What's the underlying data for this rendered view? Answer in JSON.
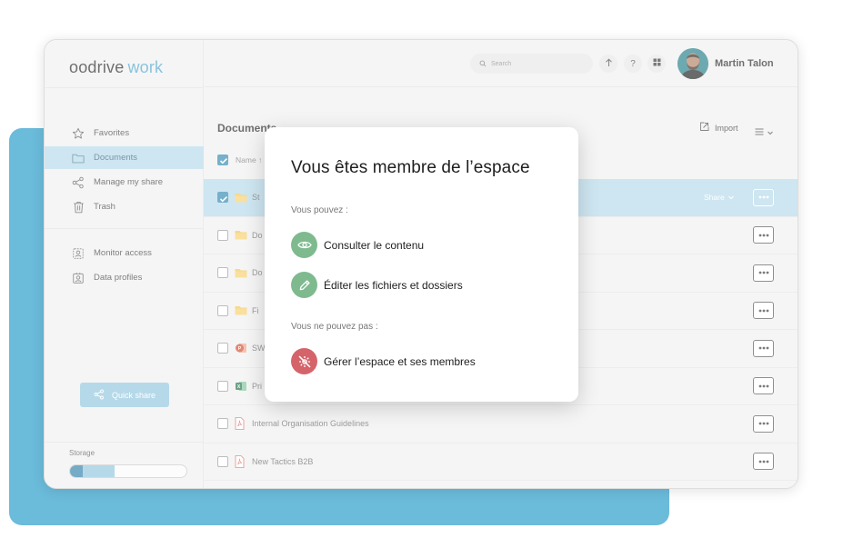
{
  "app": {
    "brand": "oodrive",
    "product": "work"
  },
  "colors": {
    "accent": "#2d86b0",
    "selected_row": "#b4d9ea",
    "allow": "#7fba8f",
    "deny": "#d5646a",
    "backdrop": "#6bbbdb"
  },
  "sidebar": {
    "items": [
      {
        "label": "Favorites",
        "icon": "star-icon"
      },
      {
        "label": "Documents",
        "icon": "folder-icon"
      },
      {
        "label": "Manage my share",
        "icon": "share-icon"
      },
      {
        "label": "Trash",
        "icon": "trash-icon"
      }
    ],
    "admin_items": [
      {
        "label": "Monitor access",
        "icon": "monitor-access-icon"
      },
      {
        "label": "Data profiles",
        "icon": "data-profile-icon"
      }
    ],
    "quick_share_label": "Quick share",
    "storage_label": "Storage",
    "storage_used_fraction": 0.38
  },
  "header": {
    "search_placeholder": "Search",
    "user_name": "Martin Talon"
  },
  "main": {
    "title": "Documents",
    "import_label": "Import",
    "name_column": "Name ↑",
    "rows": [
      {
        "name": "St",
        "icon": "folder-icon",
        "selected": true,
        "share": "Share"
      },
      {
        "name": "Do",
        "icon": "folder-icon",
        "selected": false
      },
      {
        "name": "Do",
        "icon": "folder-icon",
        "selected": false
      },
      {
        "name": "Fi",
        "icon": "folder-icon",
        "selected": false
      },
      {
        "name": "SW",
        "icon": "powerpoint-icon",
        "selected": false
      },
      {
        "name": "Pri",
        "icon": "excel-icon",
        "selected": false
      },
      {
        "name": "Internal Organisation Guidelines",
        "icon": "pdf-icon",
        "selected": false
      },
      {
        "name": "New Tactics B2B",
        "icon": "pdf-icon",
        "selected": false
      }
    ]
  },
  "modal": {
    "title": "Vous êtes membre de l’espace",
    "can_label": "Vous pouvez :",
    "cannot_label": "Vous ne pouvez pas :",
    "can": [
      {
        "label": "Consulter le contenu",
        "icon": "eye-icon"
      },
      {
        "label": "Éditer les fichiers et dossiers",
        "icon": "pencil-icon"
      }
    ],
    "cannot": [
      {
        "label": "Gérer l’espace et ses membres",
        "icon": "settings-crossed-icon"
      }
    ]
  }
}
